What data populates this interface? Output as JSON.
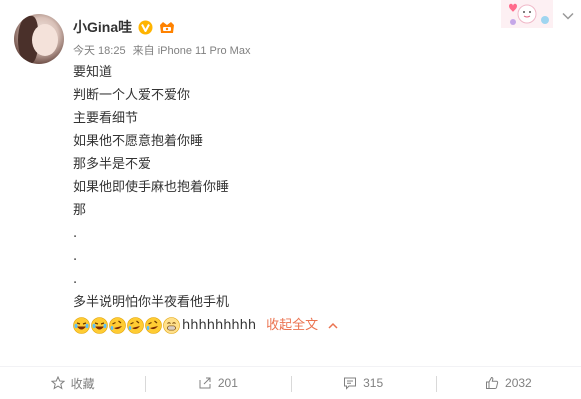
{
  "post": {
    "username": "小Gina哇",
    "time": "今天 18:25",
    "source": "来自 iPhone 11 Pro Max",
    "lines": [
      "要知道",
      "判断一个人爱不爱你",
      "主要看细节",
      "如果他不愿意抱着你睡",
      "那多半是不爱",
      "如果他即使手麻也抱着你睡",
      "那",
      ".",
      ".",
      ".",
      "多半说明怕你半夜看他手机"
    ],
    "trailing_text": "hhhhhhhhh",
    "collapse_label": "收起全文",
    "emojis": [
      "laugh-cry-emoji",
      "laugh-cry-emoji",
      "roll-laugh-emoji",
      "roll-laugh-emoji",
      "roll-laugh-emoji",
      "grin-emoji"
    ]
  },
  "footer": {
    "favorite_label": "收藏",
    "repost_count": "201",
    "comment_count": "315",
    "like_count": "2032"
  },
  "colors": {
    "accent": "#eb7350",
    "vip": "#ffb400",
    "meta": "#808080"
  }
}
